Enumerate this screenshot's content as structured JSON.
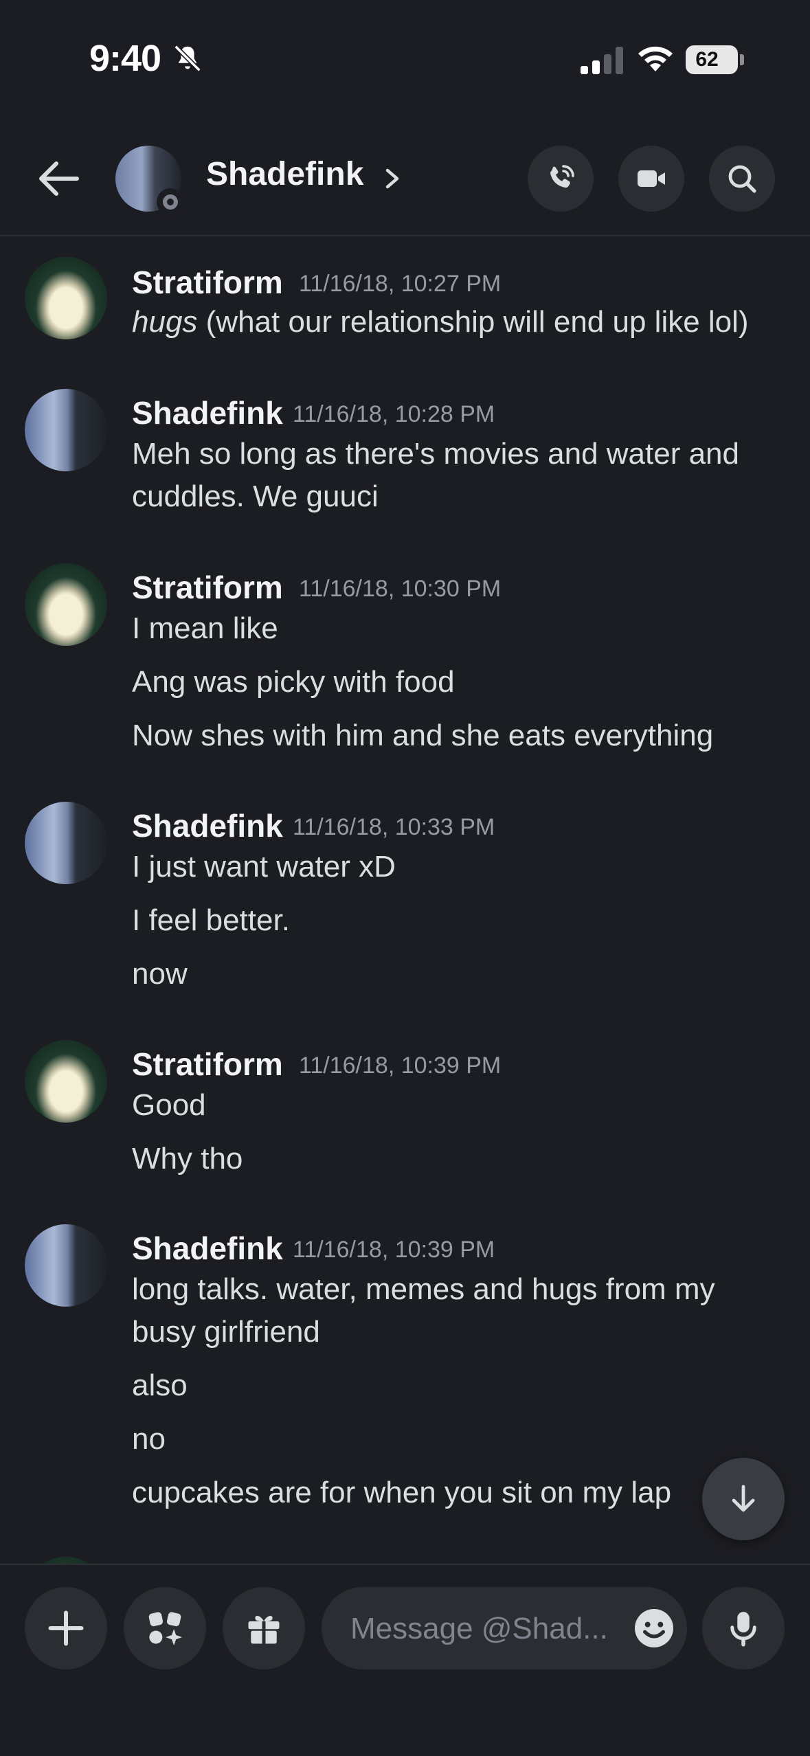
{
  "status_bar": {
    "time": "9:40",
    "battery": "62"
  },
  "header": {
    "title": "Shadefink"
  },
  "messages": [
    {
      "author": "Stratiform",
      "timestamp": "11/16/18, 10:27 PM",
      "avatar": "dog",
      "lines": [
        {
          "em": "hugs",
          "text": " (what our relationship will end up like lol)"
        }
      ]
    },
    {
      "author": "Shadefink",
      "timestamp": "11/16/18, 10:28 PM",
      "avatar": "sky",
      "lines": [
        {
          "text": "Meh so long as there's movies and water and"
        },
        {
          "text": "cuddles. We guuci"
        }
      ]
    },
    {
      "author": "Stratiform",
      "timestamp": "11/16/18, 10:30 PM",
      "avatar": "dog",
      "lines": [
        {
          "text": "I mean like"
        },
        {
          "text": "Ang was picky with food"
        },
        {
          "text": "Now shes with him and she eats everything"
        }
      ]
    },
    {
      "author": "Shadefink",
      "timestamp": "11/16/18, 10:33 PM",
      "avatar": "sky",
      "lines": [
        {
          "text": "I just want water xD"
        },
        {
          "text": "I feel better."
        },
        {
          "text": "now"
        }
      ]
    },
    {
      "author": "Stratiform",
      "timestamp": "11/16/18, 10:39 PM",
      "avatar": "dog",
      "lines": [
        {
          "text": "Good"
        },
        {
          "text": "Why tho"
        }
      ]
    },
    {
      "author": "Shadefink",
      "timestamp": "11/16/18, 10:39 PM",
      "avatar": "sky",
      "lines": [
        {
          "text": "long talks. water, memes and hugs from my"
        },
        {
          "text": "busy girlfriend"
        },
        {
          "text": "also"
        },
        {
          "text": "no"
        },
        {
          "text": "cupcakes are for when you sit on my lap"
        }
      ]
    }
  ],
  "composer": {
    "placeholder": "Message @Shad..."
  },
  "icons": {
    "back": "arrow-left-icon",
    "call": "phone-call-icon",
    "video": "video-camera-icon",
    "search": "search-icon",
    "plus": "plus-icon",
    "apps": "apps-sparkle-icon",
    "gift": "gift-icon",
    "emoji": "emoji-icon",
    "mic": "microphone-icon",
    "jump": "arrow-down-icon",
    "bell_off": "bell-slash-icon"
  },
  "colors": {
    "background": "#1c1d22",
    "button": "#2b2d33",
    "muted_text": "#949ba4",
    "text": "#dbdee1"
  }
}
